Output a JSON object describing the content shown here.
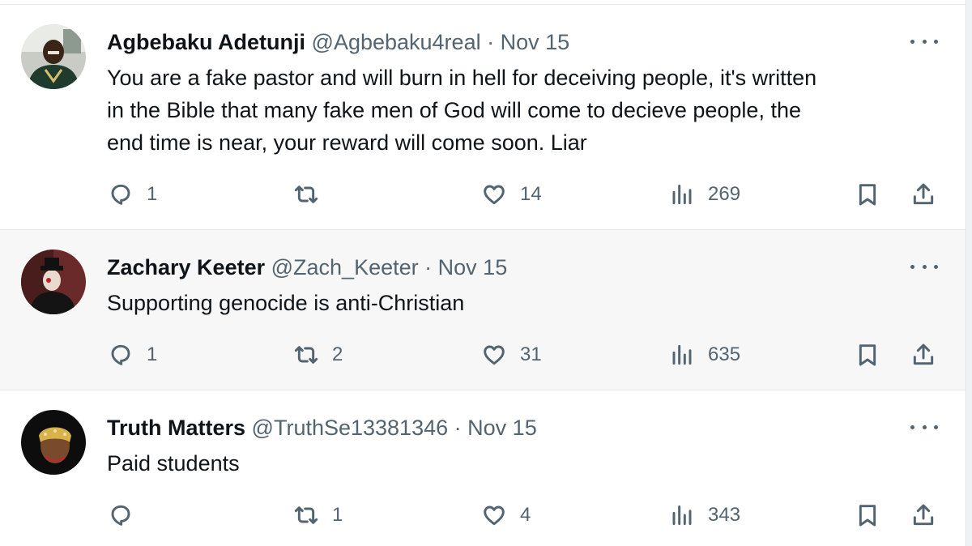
{
  "tweets": [
    {
      "name": "Agbebaku Adetunji",
      "handle": "@Agbebaku4real",
      "separator": "·",
      "date": "Nov 15",
      "text_lines": [
        "You are a fake pastor and will burn in hell for deceiving people, it's written",
        "in the Bible that many fake men of God will come to decieve people, the",
        "end time is near, your reward will come soon. Liar"
      ],
      "replies": "1",
      "retweets": "",
      "likes": "14",
      "views": "269"
    },
    {
      "name": "Zachary Keeter",
      "handle": "@Zach_Keeter",
      "separator": "·",
      "date": "Nov 15",
      "text_lines": [
        "Supporting genocide is anti-Christian"
      ],
      "replies": "1",
      "retweets": "2",
      "likes": "31",
      "views": "635"
    },
    {
      "name": "Truth Matters",
      "handle": "@TruthSe13381346",
      "separator": "·",
      "date": "Nov 15",
      "text_lines": [
        "Paid students"
      ],
      "replies": "",
      "retweets": "1",
      "likes": "4",
      "views": "343"
    }
  ],
  "icons": {
    "reply": "reply-icon",
    "retweet": "retweet-icon",
    "like": "heart-icon",
    "views": "views-icon",
    "bookmark": "bookmark-icon",
    "share": "share-icon",
    "more": "more-icon"
  },
  "colors": {
    "text": "#0f1419",
    "secondary": "#536471",
    "highlight_bg": "#f7f7f7",
    "border": "#e6e9eb"
  }
}
